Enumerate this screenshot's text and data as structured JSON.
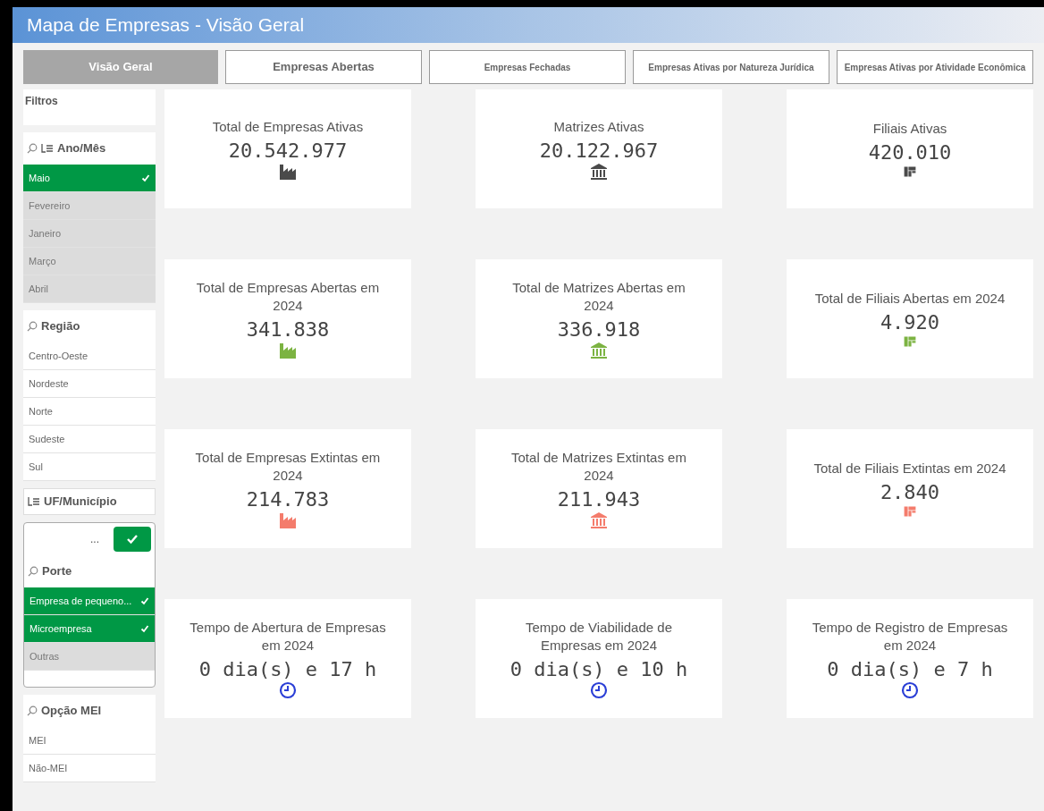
{
  "title": "Mapa de Empresas - Visão Geral",
  "tabs": [
    {
      "label": "Visão Geral",
      "selected": true
    },
    {
      "label": "Empresas Abertas",
      "selected": false
    },
    {
      "label": "Empresas Fechadas",
      "selected": false
    },
    {
      "label": "Empresas Ativas por Natureza Jurídica",
      "selected": false
    },
    {
      "label": "Empresas Ativas por Atividade Econômica",
      "selected": false
    }
  ],
  "sidebar": {
    "heading": "Filtros",
    "filters": [
      {
        "label": "Ano/Mês",
        "kind": "search-drill",
        "items": [
          {
            "label": "Maio",
            "selected": true,
            "greyed": false
          },
          {
            "label": "Fevereiro",
            "selected": false,
            "greyed": true
          },
          {
            "label": "Janeiro",
            "selected": false,
            "greyed": true
          },
          {
            "label": "Março",
            "selected": false,
            "greyed": true
          },
          {
            "label": "Abril",
            "selected": false,
            "greyed": true
          }
        ]
      },
      {
        "label": "Região",
        "kind": "search",
        "items": [
          {
            "label": "Centro-Oeste",
            "selected": false,
            "greyed": false
          },
          {
            "label": "Nordeste",
            "selected": false,
            "greyed": false
          },
          {
            "label": "Norte",
            "selected": false,
            "greyed": false
          },
          {
            "label": "Sudeste",
            "selected": false,
            "greyed": false
          },
          {
            "label": "Sul",
            "selected": false,
            "greyed": false
          }
        ]
      },
      {
        "label": "UF/Município",
        "kind": "drill"
      },
      {
        "label": "Porte",
        "kind": "popup",
        "menu": "...",
        "items": [
          {
            "label": "Empresa de pequeno...",
            "selected": true,
            "greyed": false
          },
          {
            "label": "Microempresa",
            "selected": true,
            "greyed": false
          },
          {
            "label": "Outras",
            "selected": false,
            "greyed": true
          }
        ]
      },
      {
        "label": "Opção MEI",
        "kind": "search",
        "items": [
          {
            "label": "MEI",
            "selected": false,
            "greyed": false
          },
          {
            "label": "Não-MEI",
            "selected": false,
            "greyed": false
          }
        ]
      }
    ]
  },
  "cards": [
    {
      "title": "Total de Empresas Ativas",
      "value": "20.542.977",
      "kind": "factory",
      "color": "#4a4a4a"
    },
    {
      "title": "Matrizes Ativas",
      "value": "20.122.967",
      "kind": "bank",
      "color": "#4a4a4a"
    },
    {
      "title": "Filiais Ativas",
      "value": "420.010",
      "kind": "branch",
      "color": "#4a4a4a"
    },
    {
      "title": "Total de Empresas Abertas em 2024",
      "value": "341.838",
      "kind": "factory",
      "color": "#7cb342"
    },
    {
      "title": "Total de Matrizes Abertas em 2024",
      "value": "336.918",
      "kind": "bank",
      "color": "#7cb342"
    },
    {
      "title": "Total de Filiais Abertas em 2024",
      "value": "4.920",
      "kind": "branch",
      "color": "#7cb342"
    },
    {
      "title": "Total de Empresas Extintas em 2024",
      "value": "214.783",
      "kind": "factory",
      "color": "#f47c6c"
    },
    {
      "title": "Total de Matrizes Extintas em 2024",
      "value": "211.943",
      "kind": "bank",
      "color": "#f47c6c"
    },
    {
      "title": "Total de Filiais Extintas em 2024",
      "value": "2.840",
      "kind": "branch",
      "color": "#f47c6c"
    },
    {
      "title": "Tempo de Abertura de Empresas em 2024",
      "value": "0 dia(s) e 17 h",
      "kind": "clock",
      "color": "#2b3fd6"
    },
    {
      "title": "Tempo de Viabilidade de Empresas em 2024",
      "value": "0 dia(s) e 10 h",
      "kind": "clock",
      "color": "#2b3fd6"
    },
    {
      "title": "Tempo de Registro de Empresas em 2024",
      "value": "0 dia(s) e 7 h",
      "kind": "clock",
      "color": "#2b3fd6"
    }
  ]
}
